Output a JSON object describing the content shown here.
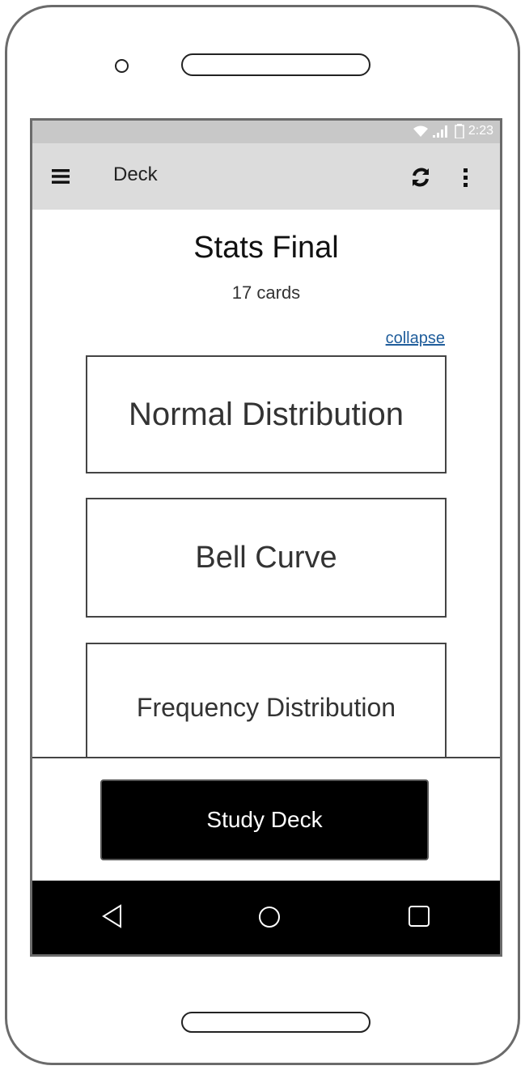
{
  "status_bar": {
    "time": "2:23",
    "icons": [
      "wifi-icon",
      "signal-icon",
      "battery-icon"
    ]
  },
  "app_bar": {
    "title": "Deck",
    "menu_icon": "hamburger-menu-icon",
    "sync_icon": "sync-icon",
    "more_icon": "more-vertical-icon"
  },
  "deck": {
    "title": "Stats Final",
    "count": "17 cards",
    "collapse_label": "collapse"
  },
  "cards": [
    {
      "label": "Normal Distribution"
    },
    {
      "label": "Bell Curve"
    },
    {
      "label": "Frequency Distribution"
    }
  ],
  "actions": {
    "study_label": "Study Deck"
  },
  "nav_bar": {
    "icons": [
      "back-icon",
      "home-icon",
      "recent-apps-icon"
    ]
  },
  "colors": {
    "status_bar": "#c8c8c8",
    "app_bar": "#dcdcdc",
    "link": "#1f5d9b",
    "button": "#000000",
    "nav_bar": "#000000"
  }
}
